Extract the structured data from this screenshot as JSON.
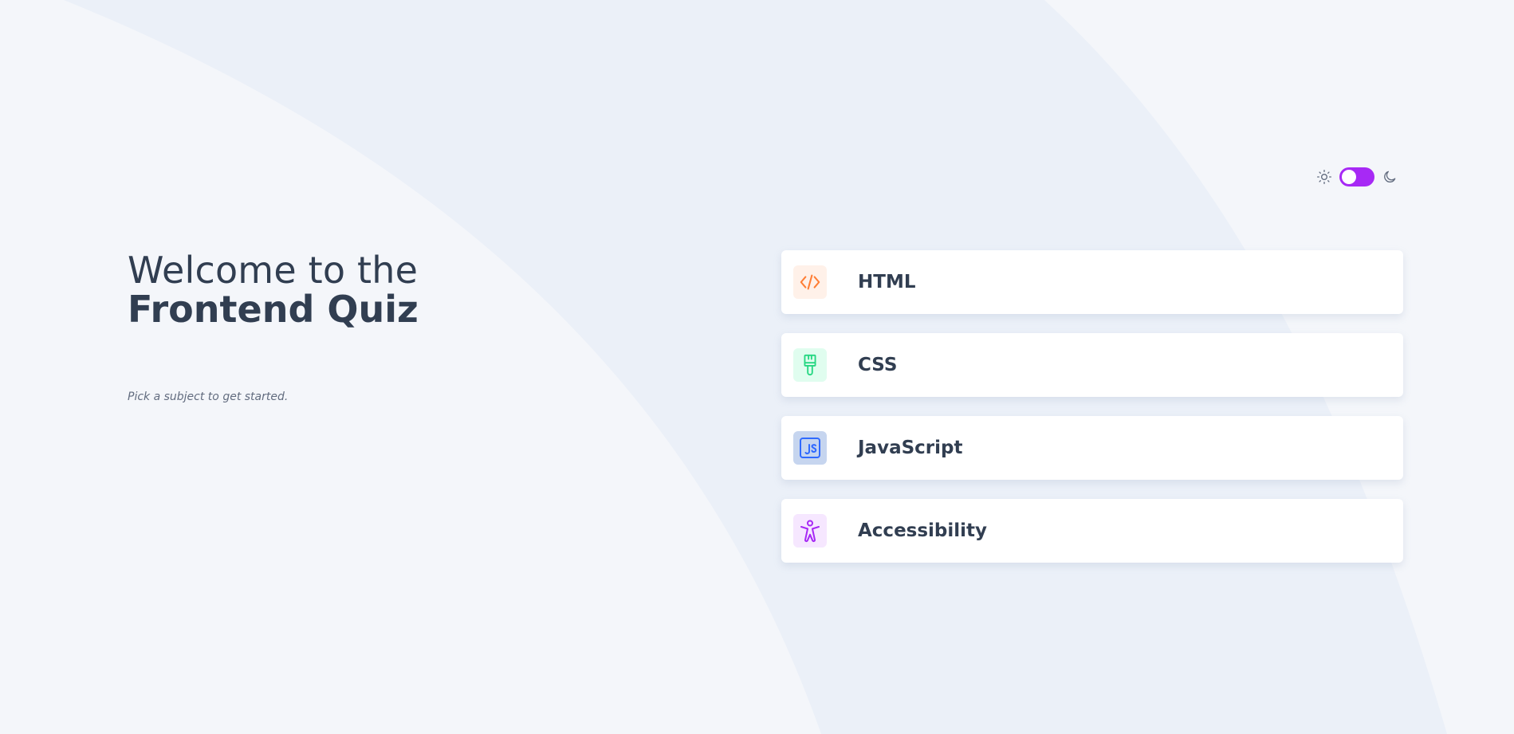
{
  "header": {
    "title_line1": "Welcome to the",
    "title_line2": "Frontend Quiz",
    "subtitle": "Pick a subject to get started."
  },
  "theme_toggle": {
    "light_icon": "sun-icon",
    "dark_icon": "moon-icon",
    "switch_color": "#a729f5"
  },
  "subjects": [
    {
      "label": "HTML",
      "icon": "html-code-icon",
      "icon_color": "#ff7e35",
      "badge_bg": "#fff1e9"
    },
    {
      "label": "CSS",
      "icon": "paintbrush-icon",
      "icon_color": "#26d782",
      "badge_bg": "#e0fdef"
    },
    {
      "label": "JavaScript",
      "icon": "js-icon",
      "icon_color": "#306aff",
      "badge_bg": "#c6d5ef"
    },
    {
      "label": "Accessibility",
      "icon": "accessibility-icon",
      "icon_color": "#a729f5",
      "badge_bg": "#f6e7ff"
    }
  ],
  "colors": {
    "background": "#f4f6fa",
    "text_dark": "#313e51",
    "text_muted": "#626c7f",
    "accent": "#a729f5"
  }
}
